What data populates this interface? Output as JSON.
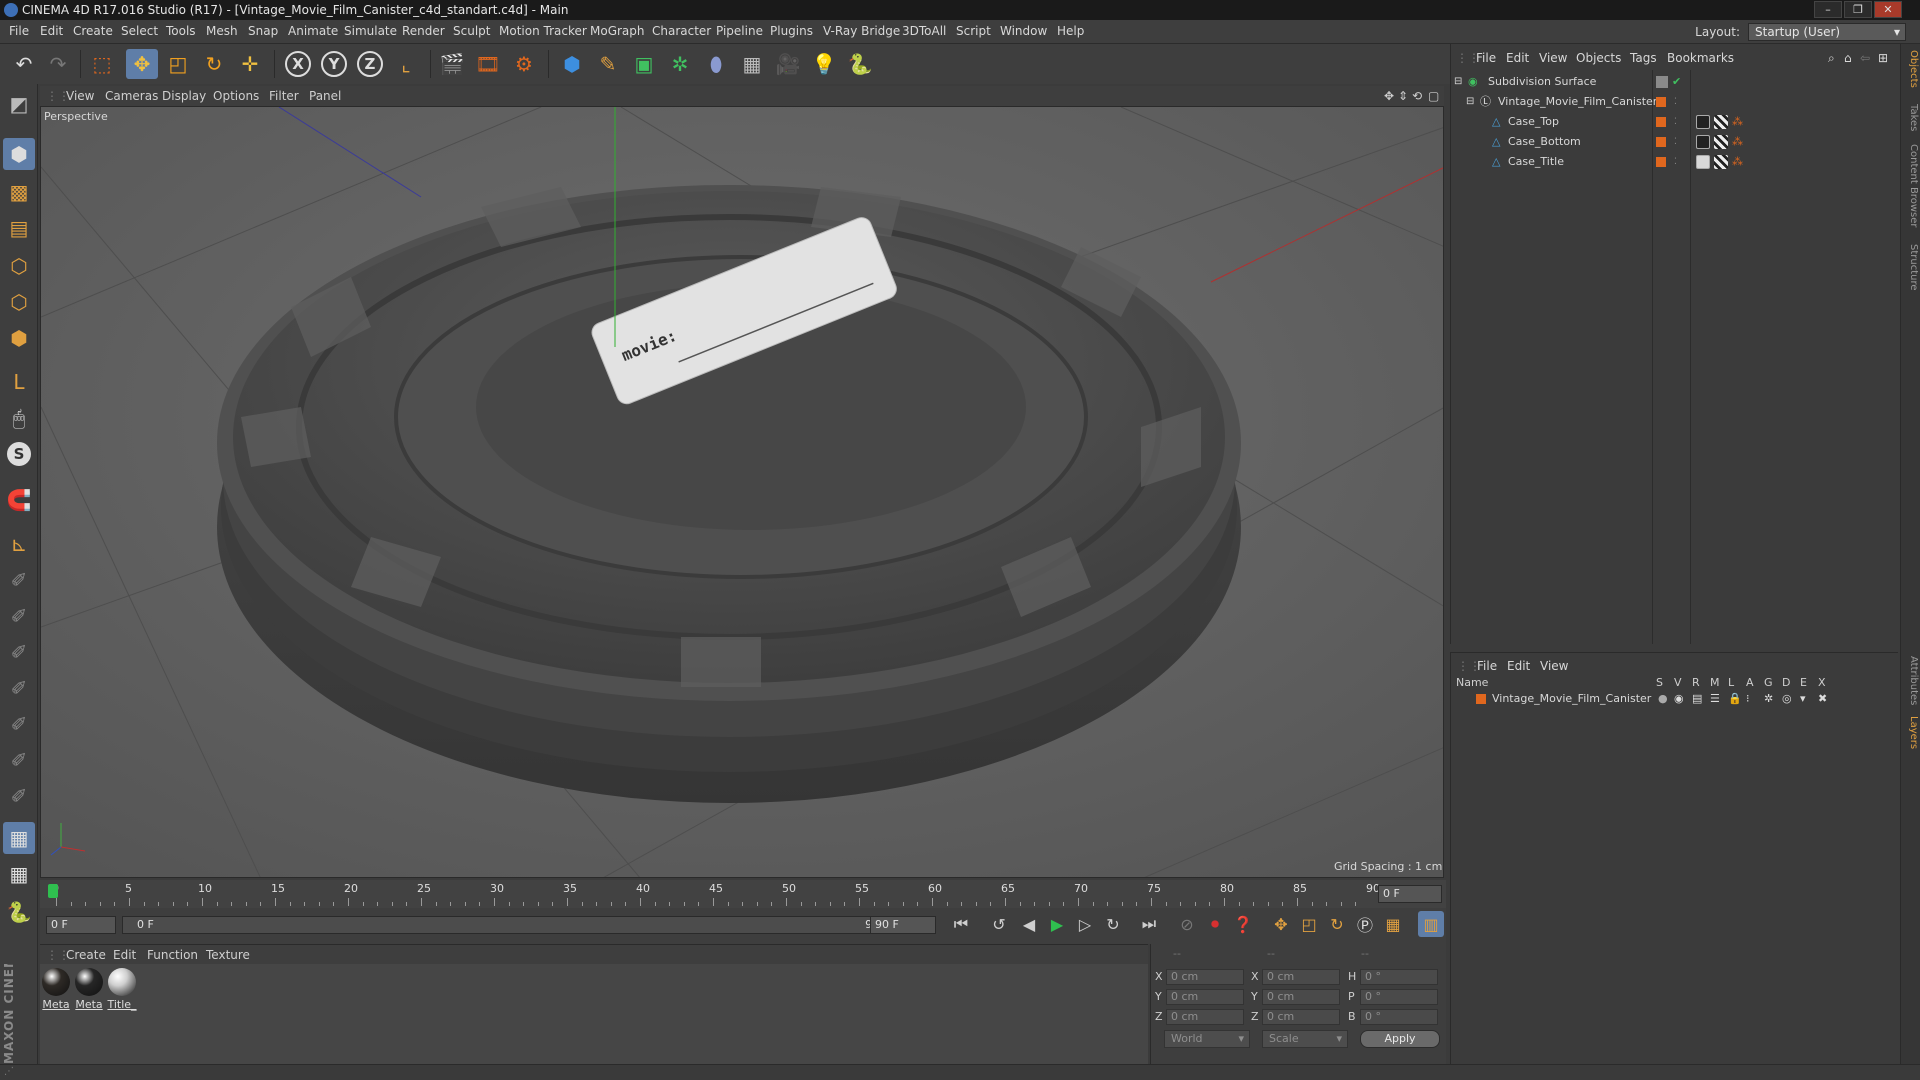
{
  "window": {
    "title": "CINEMA 4D R17.016 Studio (R17) - [Vintage_Movie_Film_Canister_c4d_standart.c4d] - Main",
    "buttons": [
      "–",
      "❐",
      "✕"
    ]
  },
  "menubar": {
    "items": [
      "File",
      "Edit",
      "Create",
      "Select",
      "Tools",
      "Mesh",
      "Snap",
      "Animate",
      "Simulate",
      "Render",
      "Sculpt",
      "Motion Tracker",
      "MoGraph",
      "Character",
      "Pipeline",
      "Plugins",
      "V-Ray Bridge",
      "3DToAll",
      "Script",
      "Window",
      "Help"
    ],
    "layout_label": "Layout:",
    "layout_value": "Startup (User)"
  },
  "toolbar": {
    "axis_x": "X",
    "axis_y": "Y",
    "axis_z": "Z"
  },
  "viewport": {
    "menu": [
      "View",
      "Cameras",
      "Display",
      "Options",
      "Filter",
      "Panel"
    ],
    "label": "Perspective",
    "grid_spacing": "Grid Spacing : 1 cm",
    "label_text": "movie:"
  },
  "timeline": {
    "ticks": [
      "0",
      "5",
      "10",
      "15",
      "20",
      "25",
      "30",
      "35",
      "40",
      "45",
      "50",
      "55",
      "60",
      "65",
      "70",
      "75",
      "80",
      "85",
      "90"
    ],
    "current_frame_right": "0 F",
    "start_field": "0 F",
    "range_start": "0 F",
    "range_end": "90 F",
    "end_field": "90 F"
  },
  "materials": {
    "menu": [
      "Create",
      "Edit",
      "Function",
      "Texture"
    ],
    "items": [
      {
        "label": "Meta",
        "color": "#2e2a26"
      },
      {
        "label": "Meta",
        "color": "#262626"
      },
      {
        "label": "Title_",
        "color": "#cfcfcf"
      }
    ]
  },
  "coords": {
    "header": [
      "--",
      "--",
      "--"
    ],
    "pos_labels": [
      "X",
      "Y",
      "Z"
    ],
    "pos_values": [
      "0 cm",
      "0 cm",
      "0 cm"
    ],
    "size_labels": [
      "X",
      "Y",
      "Z"
    ],
    "size_values": [
      "0 cm",
      "0 cm",
      "0 cm"
    ],
    "rot_labels": [
      "H",
      "P",
      "B"
    ],
    "rot_values": [
      "0 °",
      "0 °",
      "0 °"
    ],
    "mode_world": "World",
    "mode_scale": "Scale",
    "apply": "Apply"
  },
  "objects": {
    "menu": [
      "File",
      "Edit",
      "View",
      "Objects",
      "Tags",
      "Bookmarks"
    ],
    "rows": [
      {
        "name": "Subdivision Surface"
      },
      {
        "name": "Vintage_Movie_Film_Canister"
      },
      {
        "name": "Case_Top"
      },
      {
        "name": "Case_Bottom"
      },
      {
        "name": "Case_Title"
      }
    ]
  },
  "layers": {
    "menu": [
      "File",
      "Edit",
      "View"
    ],
    "header_name": "Name",
    "columns": [
      "S",
      "V",
      "R",
      "M",
      "L",
      "A",
      "G",
      "D",
      "E",
      "X"
    ],
    "rows": [
      {
        "name": "Vintage_Movie_Film_Canister"
      }
    ]
  },
  "right_tabs": [
    "Objects",
    "Takes",
    "Content Browser",
    "Structure",
    "Attributes",
    "Layers"
  ],
  "brand": "MAXON CINEMA 4D",
  "colors": {
    "accent_orange": "#e0671e",
    "accent_blue": "#3d8fe0",
    "timeline_marker": "#2fbf4f"
  }
}
